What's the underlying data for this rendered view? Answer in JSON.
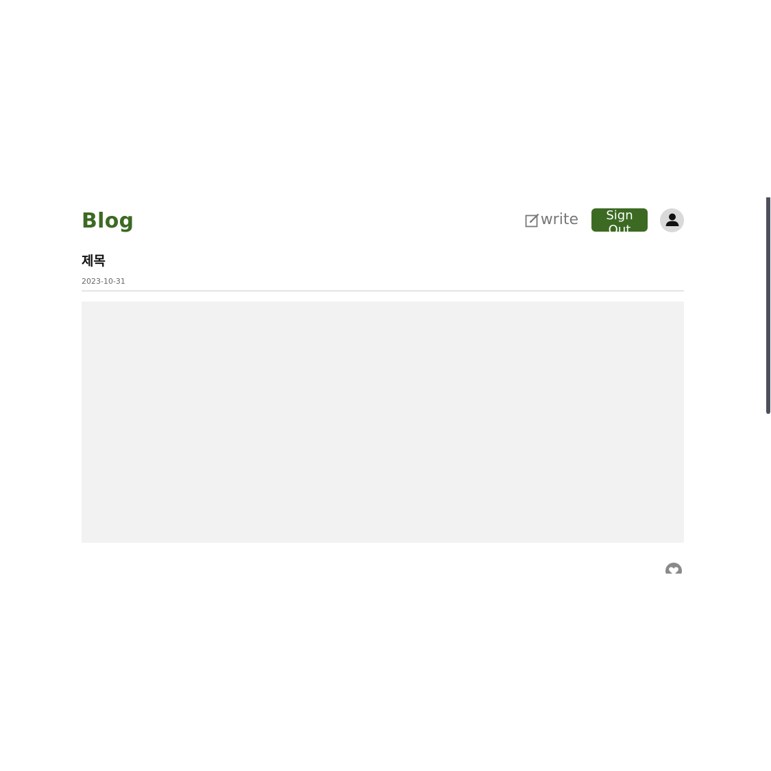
{
  "header": {
    "logo": "Blog",
    "write_label": "write",
    "signout_label": "Sign Out"
  },
  "post": {
    "title": "제목",
    "date": "2023-10-31"
  },
  "icons": {
    "write": "edit-square-icon",
    "avatar": "user-icon",
    "like": "heart-icon"
  },
  "colors": {
    "brand": "#3c6a23",
    "content_bg": "#f2f2f2",
    "muted": "#777777"
  }
}
